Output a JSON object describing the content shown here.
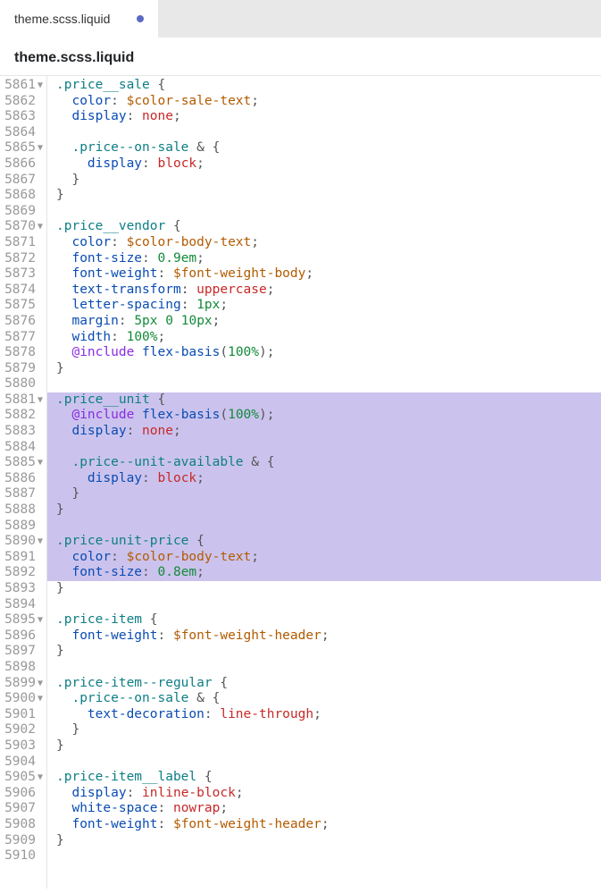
{
  "tab": {
    "label": "theme.scss.liquid",
    "modified": true
  },
  "header": {
    "filename": "theme.scss.liquid"
  },
  "lines": [
    {
      "n": 5861,
      "fold": true,
      "hl": false,
      "tokens": [
        {
          "t": ".price__sale",
          "c": "t-sel"
        },
        {
          "t": " {",
          "c": "t-punc"
        }
      ]
    },
    {
      "n": 5862,
      "fold": false,
      "hl": false,
      "tokens": [
        {
          "t": "  "
        },
        {
          "t": "color",
          "c": "t-prop"
        },
        {
          "t": ": ",
          "c": "t-punc"
        },
        {
          "t": "$color-sale-text",
          "c": "t-var"
        },
        {
          "t": ";",
          "c": "t-punc"
        }
      ]
    },
    {
      "n": 5863,
      "fold": false,
      "hl": false,
      "tokens": [
        {
          "t": "  "
        },
        {
          "t": "display",
          "c": "t-prop"
        },
        {
          "t": ": ",
          "c": "t-punc"
        },
        {
          "t": "none",
          "c": "t-val"
        },
        {
          "t": ";",
          "c": "t-punc"
        }
      ]
    },
    {
      "n": 5864,
      "fold": false,
      "hl": false,
      "tokens": []
    },
    {
      "n": 5865,
      "fold": true,
      "hl": false,
      "tokens": [
        {
          "t": "  "
        },
        {
          "t": ".price--on-sale",
          "c": "t-sel"
        },
        {
          "t": " & {",
          "c": "t-punc"
        }
      ]
    },
    {
      "n": 5866,
      "fold": false,
      "hl": false,
      "tokens": [
        {
          "t": "    "
        },
        {
          "t": "display",
          "c": "t-prop"
        },
        {
          "t": ": ",
          "c": "t-punc"
        },
        {
          "t": "block",
          "c": "t-val"
        },
        {
          "t": ";",
          "c": "t-punc"
        }
      ]
    },
    {
      "n": 5867,
      "fold": false,
      "hl": false,
      "tokens": [
        {
          "t": "  }",
          "c": "t-punc"
        }
      ]
    },
    {
      "n": 5868,
      "fold": false,
      "hl": false,
      "tokens": [
        {
          "t": "}",
          "c": "t-punc"
        }
      ]
    },
    {
      "n": 5869,
      "fold": false,
      "hl": false,
      "tokens": []
    },
    {
      "n": 5870,
      "fold": true,
      "hl": false,
      "tokens": [
        {
          "t": ".price__vendor",
          "c": "t-sel"
        },
        {
          "t": " {",
          "c": "t-punc"
        }
      ]
    },
    {
      "n": 5871,
      "fold": false,
      "hl": false,
      "tokens": [
        {
          "t": "  "
        },
        {
          "t": "color",
          "c": "t-prop"
        },
        {
          "t": ": ",
          "c": "t-punc"
        },
        {
          "t": "$color-body-text",
          "c": "t-var"
        },
        {
          "t": ";",
          "c": "t-punc"
        }
      ]
    },
    {
      "n": 5872,
      "fold": false,
      "hl": false,
      "tokens": [
        {
          "t": "  "
        },
        {
          "t": "font-size",
          "c": "t-prop"
        },
        {
          "t": ": ",
          "c": "t-punc"
        },
        {
          "t": "0.9em",
          "c": "t-num"
        },
        {
          "t": ";",
          "c": "t-punc"
        }
      ]
    },
    {
      "n": 5873,
      "fold": false,
      "hl": false,
      "tokens": [
        {
          "t": "  "
        },
        {
          "t": "font-weight",
          "c": "t-prop"
        },
        {
          "t": ": ",
          "c": "t-punc"
        },
        {
          "t": "$font-weight-body",
          "c": "t-var"
        },
        {
          "t": ";",
          "c": "t-punc"
        }
      ]
    },
    {
      "n": 5874,
      "fold": false,
      "hl": false,
      "tokens": [
        {
          "t": "  "
        },
        {
          "t": "text-transform",
          "c": "t-prop"
        },
        {
          "t": ": ",
          "c": "t-punc"
        },
        {
          "t": "uppercase",
          "c": "t-val"
        },
        {
          "t": ";",
          "c": "t-punc"
        }
      ]
    },
    {
      "n": 5875,
      "fold": false,
      "hl": false,
      "tokens": [
        {
          "t": "  "
        },
        {
          "t": "letter-spacing",
          "c": "t-prop"
        },
        {
          "t": ": ",
          "c": "t-punc"
        },
        {
          "t": "1px",
          "c": "t-num"
        },
        {
          "t": ";",
          "c": "t-punc"
        }
      ]
    },
    {
      "n": 5876,
      "fold": false,
      "hl": false,
      "tokens": [
        {
          "t": "  "
        },
        {
          "t": "margin",
          "c": "t-prop"
        },
        {
          "t": ": ",
          "c": "t-punc"
        },
        {
          "t": "5px",
          "c": "t-num"
        },
        {
          "t": " "
        },
        {
          "t": "0",
          "c": "t-num"
        },
        {
          "t": " "
        },
        {
          "t": "10px",
          "c": "t-num"
        },
        {
          "t": ";",
          "c": "t-punc"
        }
      ]
    },
    {
      "n": 5877,
      "fold": false,
      "hl": false,
      "tokens": [
        {
          "t": "  "
        },
        {
          "t": "width",
          "c": "t-prop"
        },
        {
          "t": ": ",
          "c": "t-punc"
        },
        {
          "t": "100%",
          "c": "t-num"
        },
        {
          "t": ";",
          "c": "t-punc"
        }
      ]
    },
    {
      "n": 5878,
      "fold": false,
      "hl": false,
      "tokens": [
        {
          "t": "  "
        },
        {
          "t": "@include",
          "c": "t-kw"
        },
        {
          "t": " "
        },
        {
          "t": "flex-basis",
          "c": "t-fn"
        },
        {
          "t": "(",
          "c": "t-punc"
        },
        {
          "t": "100%",
          "c": "t-num"
        },
        {
          "t": ");",
          "c": "t-punc"
        }
      ]
    },
    {
      "n": 5879,
      "fold": false,
      "hl": false,
      "tokens": [
        {
          "t": "}",
          "c": "t-punc"
        }
      ]
    },
    {
      "n": 5880,
      "fold": false,
      "hl": false,
      "tokens": []
    },
    {
      "n": 5881,
      "fold": true,
      "hl": true,
      "tokens": [
        {
          "t": ".price__unit",
          "c": "t-sel"
        },
        {
          "t": " {",
          "c": "t-punc"
        }
      ]
    },
    {
      "n": 5882,
      "fold": false,
      "hl": true,
      "tokens": [
        {
          "t": "  "
        },
        {
          "t": "@include",
          "c": "t-kw"
        },
        {
          "t": " "
        },
        {
          "t": "flex-basis",
          "c": "t-fn"
        },
        {
          "t": "(",
          "c": "t-punc"
        },
        {
          "t": "100%",
          "c": "t-num"
        },
        {
          "t": ");",
          "c": "t-punc"
        }
      ]
    },
    {
      "n": 5883,
      "fold": false,
      "hl": true,
      "tokens": [
        {
          "t": "  "
        },
        {
          "t": "display",
          "c": "t-prop"
        },
        {
          "t": ": ",
          "c": "t-punc"
        },
        {
          "t": "none",
          "c": "t-val"
        },
        {
          "t": ";",
          "c": "t-punc"
        }
      ]
    },
    {
      "n": 5884,
      "fold": false,
      "hl": true,
      "tokens": []
    },
    {
      "n": 5885,
      "fold": true,
      "hl": true,
      "tokens": [
        {
          "t": "  "
        },
        {
          "t": ".price--unit-available",
          "c": "t-sel"
        },
        {
          "t": " & {",
          "c": "t-punc"
        }
      ]
    },
    {
      "n": 5886,
      "fold": false,
      "hl": true,
      "tokens": [
        {
          "t": "    "
        },
        {
          "t": "display",
          "c": "t-prop"
        },
        {
          "t": ": ",
          "c": "t-punc"
        },
        {
          "t": "block",
          "c": "t-val"
        },
        {
          "t": ";",
          "c": "t-punc"
        }
      ]
    },
    {
      "n": 5887,
      "fold": false,
      "hl": true,
      "tokens": [
        {
          "t": "  }",
          "c": "t-punc"
        }
      ]
    },
    {
      "n": 5888,
      "fold": false,
      "hl": true,
      "tokens": [
        {
          "t": "}",
          "c": "t-punc"
        }
      ]
    },
    {
      "n": 5889,
      "fold": false,
      "hl": true,
      "tokens": []
    },
    {
      "n": 5890,
      "fold": true,
      "hl": true,
      "tokens": [
        {
          "t": ".price-unit-price",
          "c": "t-sel"
        },
        {
          "t": " {",
          "c": "t-punc"
        }
      ]
    },
    {
      "n": 5891,
      "fold": false,
      "hl": true,
      "tokens": [
        {
          "t": "  "
        },
        {
          "t": "color",
          "c": "t-prop"
        },
        {
          "t": ": ",
          "c": "t-punc"
        },
        {
          "t": "$color-body-text",
          "c": "t-var"
        },
        {
          "t": ";",
          "c": "t-punc"
        }
      ]
    },
    {
      "n": 5892,
      "fold": false,
      "hl": true,
      "tokens": [
        {
          "t": "  "
        },
        {
          "t": "font-size",
          "c": "t-prop"
        },
        {
          "t": ": ",
          "c": "t-punc"
        },
        {
          "t": "0.8em",
          "c": "t-num"
        },
        {
          "t": ";",
          "c": "t-punc"
        }
      ]
    },
    {
      "n": 5893,
      "fold": false,
      "hl": false,
      "tokens": [
        {
          "t": "}",
          "c": "t-punc"
        }
      ]
    },
    {
      "n": 5894,
      "fold": false,
      "hl": false,
      "tokens": []
    },
    {
      "n": 5895,
      "fold": true,
      "hl": false,
      "tokens": [
        {
          "t": ".price-item",
          "c": "t-sel"
        },
        {
          "t": " {",
          "c": "t-punc"
        }
      ]
    },
    {
      "n": 5896,
      "fold": false,
      "hl": false,
      "tokens": [
        {
          "t": "  "
        },
        {
          "t": "font-weight",
          "c": "t-prop"
        },
        {
          "t": ": ",
          "c": "t-punc"
        },
        {
          "t": "$font-weight-header",
          "c": "t-var"
        },
        {
          "t": ";",
          "c": "t-punc"
        }
      ]
    },
    {
      "n": 5897,
      "fold": false,
      "hl": false,
      "tokens": [
        {
          "t": "}",
          "c": "t-punc"
        }
      ]
    },
    {
      "n": 5898,
      "fold": false,
      "hl": false,
      "tokens": []
    },
    {
      "n": 5899,
      "fold": true,
      "hl": false,
      "tokens": [
        {
          "t": ".price-item--regular",
          "c": "t-sel"
        },
        {
          "t": " {",
          "c": "t-punc"
        }
      ]
    },
    {
      "n": 5900,
      "fold": true,
      "hl": false,
      "tokens": [
        {
          "t": "  "
        },
        {
          "t": ".price--on-sale",
          "c": "t-sel"
        },
        {
          "t": " & {",
          "c": "t-punc"
        }
      ]
    },
    {
      "n": 5901,
      "fold": false,
      "hl": false,
      "tokens": [
        {
          "t": "    "
        },
        {
          "t": "text-decoration",
          "c": "t-prop"
        },
        {
          "t": ": ",
          "c": "t-punc"
        },
        {
          "t": "line-through",
          "c": "t-val"
        },
        {
          "t": ";",
          "c": "t-punc"
        }
      ]
    },
    {
      "n": 5902,
      "fold": false,
      "hl": false,
      "tokens": [
        {
          "t": "  }",
          "c": "t-punc"
        }
      ]
    },
    {
      "n": 5903,
      "fold": false,
      "hl": false,
      "tokens": [
        {
          "t": "}",
          "c": "t-punc"
        }
      ]
    },
    {
      "n": 5904,
      "fold": false,
      "hl": false,
      "tokens": []
    },
    {
      "n": 5905,
      "fold": true,
      "hl": false,
      "tokens": [
        {
          "t": ".price-item__label",
          "c": "t-sel"
        },
        {
          "t": " {",
          "c": "t-punc"
        }
      ]
    },
    {
      "n": 5906,
      "fold": false,
      "hl": false,
      "tokens": [
        {
          "t": "  "
        },
        {
          "t": "display",
          "c": "t-prop"
        },
        {
          "t": ": ",
          "c": "t-punc"
        },
        {
          "t": "inline-block",
          "c": "t-val"
        },
        {
          "t": ";",
          "c": "t-punc"
        }
      ]
    },
    {
      "n": 5907,
      "fold": false,
      "hl": false,
      "tokens": [
        {
          "t": "  "
        },
        {
          "t": "white-space",
          "c": "t-prop"
        },
        {
          "t": ": ",
          "c": "t-punc"
        },
        {
          "t": "nowrap",
          "c": "t-val"
        },
        {
          "t": ";",
          "c": "t-punc"
        }
      ]
    },
    {
      "n": 5908,
      "fold": false,
      "hl": false,
      "tokens": [
        {
          "t": "  "
        },
        {
          "t": "font-weight",
          "c": "t-prop"
        },
        {
          "t": ": ",
          "c": "t-punc"
        },
        {
          "t": "$font-weight-header",
          "c": "t-var"
        },
        {
          "t": ";",
          "c": "t-punc"
        }
      ]
    },
    {
      "n": 5909,
      "fold": false,
      "hl": false,
      "tokens": [
        {
          "t": "}",
          "c": "t-punc"
        }
      ]
    },
    {
      "n": 5910,
      "fold": false,
      "hl": false,
      "tokens": []
    }
  ]
}
